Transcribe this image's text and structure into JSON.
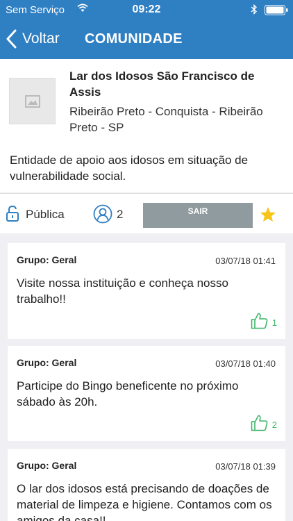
{
  "status_bar": {
    "carrier": "Sem Serviço",
    "time": "09:22",
    "icons": [
      "wifi-icon",
      "bluetooth-icon",
      "battery-icon"
    ]
  },
  "nav": {
    "back_label": "Voltar",
    "title": "COMUNIDADE",
    "color": "#2f7fc3"
  },
  "community": {
    "name": "Lar dos Idosos São Francisco de Assis",
    "location": "Ribeirão Preto - Conquista - Ribeirão Preto - SP",
    "description": "Entidade de apoio aos idosos em situação de vulnerabilidade social.",
    "image_icon": "image-placeholder-icon"
  },
  "actions": {
    "visibility": "Pública",
    "members_count": "2",
    "leave_label": "SAIR",
    "favorite": true,
    "star_color": "#f5c518",
    "leave_button_color": "#8f9b9e"
  },
  "posts": [
    {
      "group": "Grupo: Geral",
      "date": "03/07/18 01:41",
      "text": "Visite nossa instituição e conheça nosso trabalho!!",
      "likes": "1"
    },
    {
      "group": "Grupo: Geral",
      "date": "03/07/18 01:40",
      "text": "Participe do Bingo beneficente no próximo sábado às 20h.",
      "likes": "2"
    },
    {
      "group": "Grupo: Geral",
      "date": "03/07/18 01:39",
      "text": "O lar dos idosos está precisando de doações de material de limpeza e higiene. Contamos com os amigos da casa!!"
    }
  ],
  "like_color": "#3cb567"
}
